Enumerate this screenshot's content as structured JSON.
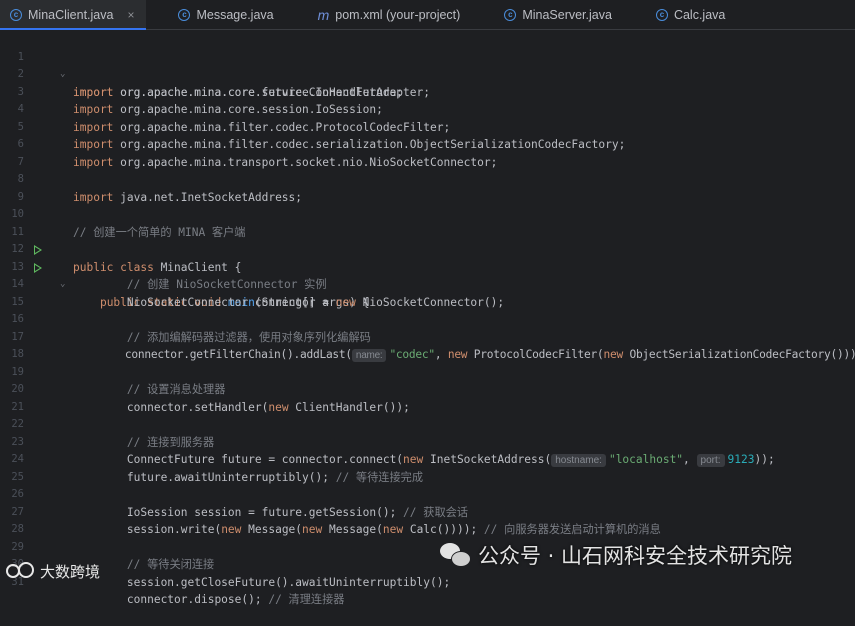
{
  "tabs": [
    {
      "label": "MinaClient.java",
      "icon": "class-icon",
      "active": true,
      "closable": true
    },
    {
      "label": "Message.java",
      "icon": "class-icon"
    },
    {
      "label": "pom.xml (your-project)",
      "icon": "maven-icon"
    },
    {
      "label": "MinaServer.java",
      "icon": "class-icon"
    },
    {
      "label": "Calc.java",
      "icon": "class-icon"
    }
  ],
  "close_glyph": "×",
  "line_numbers": [
    "1",
    "2",
    "3",
    "4",
    "5",
    "6",
    "7",
    "8",
    "9",
    "10",
    "11",
    "12",
    "13",
    "14",
    "15",
    "16",
    "17",
    "18",
    "19",
    "20",
    "21",
    "22",
    "23",
    "24",
    "25",
    "26",
    "27",
    "28",
    "29",
    "30",
    "31"
  ],
  "code": {
    "l1": {
      "kw": "import",
      "rest": " org.apache.mina.core.future.ConnectFuture;"
    },
    "l2": {
      "kw": "import",
      "rest": " org.apache.mina.core.service.IoHandlerAdapter;"
    },
    "l3": {
      "kw": "import",
      "rest": " org.apache.mina.core.session.IoSession;"
    },
    "l4": {
      "kw": "import",
      "rest": " org.apache.mina.filter.codec.ProtocolCodecFilter;"
    },
    "l5": {
      "kw": "import",
      "rest": " org.apache.mina.filter.codec.serialization.ObjectSerializationCodecFactory;"
    },
    "l6": {
      "kw": "import",
      "rest": " org.apache.mina.transport.socket.nio.NioSocketConnector;"
    },
    "l8": {
      "kw": "import",
      "rest": " java.net.InetSocketAddress;"
    },
    "l10": {
      "cmt": "// 创建一个简单的 MINA 客户端"
    },
    "l11": {
      "kw": "public class",
      "rest": " MinaClient {"
    },
    "l12": {
      "kw": "public static void",
      "fn": "main",
      "rest": "(String[] args) {"
    },
    "l13": {
      "cmt": "// 创建 NioSocketConnector 实例"
    },
    "l14": {
      "a": "NioSocketConnector connector = ",
      "kw": "new",
      "b": " NioSocketConnector();"
    },
    "l16": {
      "cmt": "// 添加编解码器过滤器，使用对象序列化编解码"
    },
    "l17": {
      "a": "connector.getFilterChain().addLast(",
      "hint": "name:",
      "str": "\"codec\"",
      "b": ", ",
      "kw": "new",
      "c": " ProtocolCodecFilter(",
      "kw2": "new",
      "d": " ObjectSerializationCodecFactory()));"
    },
    "l19": {
      "cmt": "// 设置消息处理器"
    },
    "l20": {
      "a": "connector.setHandler(",
      "kw": "new",
      "b": " ClientHandler());"
    },
    "l22": {
      "cmt": "// 连接到服务器"
    },
    "l23": {
      "a": "ConnectFuture future = connector.connect(",
      "kw": "new",
      "b": " InetSocketAddress(",
      "hint": "hostname:",
      "str": "\"localhost\"",
      "c": ", ",
      "hint2": "port:",
      "num": "9123",
      "d": "));"
    },
    "l24": {
      "a": "future.awaitUninterruptibly(); ",
      "cmt": "// 等待连接完成"
    },
    "l26": {
      "a": "IoSession session = future.getSession(); ",
      "cmt": "// 获取会话"
    },
    "l27": {
      "a": "session.write(",
      "kw": "new",
      "b": " Message(",
      "kw2": "new",
      "c": " Message(",
      "kw3": "new",
      "d": " Calc()))); ",
      "cmt": "// 向服务器发送启动计算机的消息"
    },
    "l29": {
      "cmt": "// 等待关闭连接"
    },
    "l30": {
      "a": "session.getCloseFuture().awaitUninterruptibly();"
    },
    "l31": {
      "a": "connector.dispose(); ",
      "cmt": "// 清理连接器"
    }
  },
  "watermark": {
    "right": "公众号 · 山石网科安全技术研究院",
    "left": "大数跨境"
  }
}
